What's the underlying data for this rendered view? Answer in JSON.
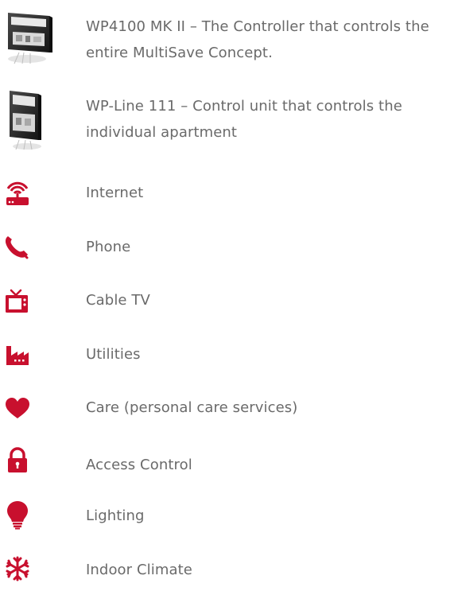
{
  "items": [
    {
      "icon": "controller-device-icon",
      "label": "WP4100 MK II – The Controller that controls the entire MultiSave Concept."
    },
    {
      "icon": "control-unit-device-icon",
      "label": "WP-Line 111 – Control unit that controls the individual apartment"
    },
    {
      "icon": "router-wifi-icon",
      "label": "Internet"
    },
    {
      "icon": "phone-icon",
      "label": "Phone"
    },
    {
      "icon": "tv-icon",
      "label": "Cable TV"
    },
    {
      "icon": "factory-icon",
      "label": "Utilities"
    },
    {
      "icon": "heart-icon",
      "label": "Care (personal care services)"
    },
    {
      "icon": "lock-icon",
      "label": "Access Control"
    },
    {
      "icon": "lightbulb-icon",
      "label": "Lighting"
    },
    {
      "icon": "snowflake-icon",
      "label": "Indoor Climate"
    }
  ],
  "colors": {
    "icon_red": "#c8102e",
    "text": "#6a6a6a"
  }
}
